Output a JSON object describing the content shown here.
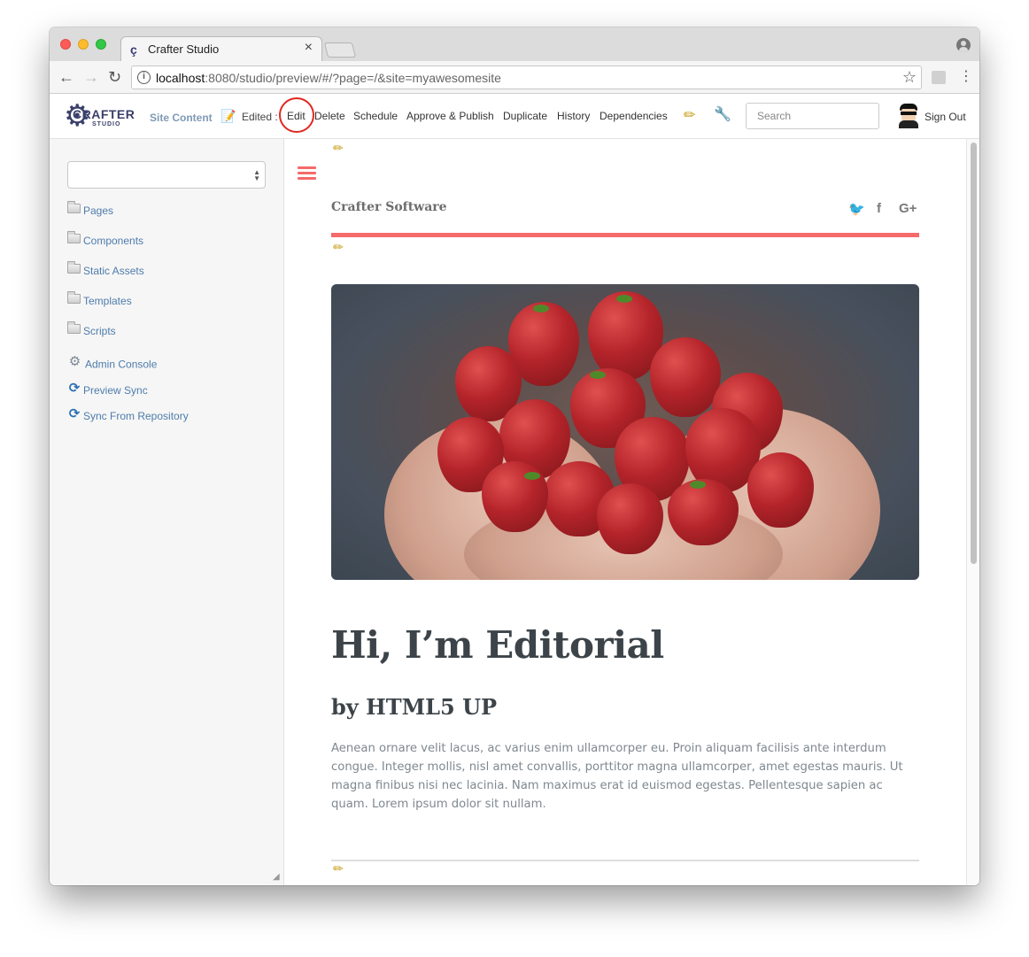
{
  "browser": {
    "tab_title": "Crafter Studio",
    "tab_close": "×",
    "url_host": "localhost",
    "url_rest": ":8080/studio/preview/#/?page=/&site=myawesomesite"
  },
  "studio_toolbar": {
    "logo_text": "CRAFTER",
    "logo_sub": "STUDIO",
    "site_content": "Site Content",
    "edited_label": "Edited :",
    "actions": {
      "edit": "Edit",
      "delete": "Delete",
      "schedule": "Schedule",
      "approve_publish": "Approve & Publish",
      "duplicate": "Duplicate",
      "history": "History",
      "dependencies": "Dependencies"
    },
    "search_placeholder": "Search",
    "sign_out": "Sign Out"
  },
  "sidebar": {
    "items": [
      {
        "label": "Pages",
        "icon": "folder-icon"
      },
      {
        "label": "Components",
        "icon": "folder-icon"
      },
      {
        "label": "Static Assets",
        "icon": "folder-icon"
      },
      {
        "label": "Templates",
        "icon": "folder-icon"
      },
      {
        "label": "Scripts",
        "icon": "folder-icon"
      },
      {
        "label": "Admin Console",
        "icon": "gear-icon"
      },
      {
        "label": "Preview Sync",
        "icon": "sync-icon"
      },
      {
        "label": "Sync From Repository",
        "icon": "sync-icon"
      }
    ]
  },
  "preview": {
    "brand": "Crafter Software",
    "social": [
      "twitter-icon",
      "facebook-icon",
      "google-plus-icon"
    ],
    "social_glyphs": {
      "twitter": "🐦",
      "facebook": "f",
      "google_plus": "G+"
    },
    "title": "Hi, I’m Editorial",
    "byline": "by HTML5 UP",
    "body": "Aenean ornare velit lacus, ac varius enim ullamcorper eu. Proin aliquam facilisis ante interdum congue. Integer mollis, nisl amet convallis, porttitor magna ullamcorper, amet egestas mauris. Ut magna finibus nisi nec lacinia. Nam maximus erat id euismod egestas. Pellentesque sapien ac quam. Lorem ipsum dolor sit nullam.",
    "banner_image": "strawberries-in-hands"
  },
  "colors": {
    "accent": "#f56a6a",
    "link": "#4e7cac",
    "highlight_circle": "#e0281f"
  }
}
